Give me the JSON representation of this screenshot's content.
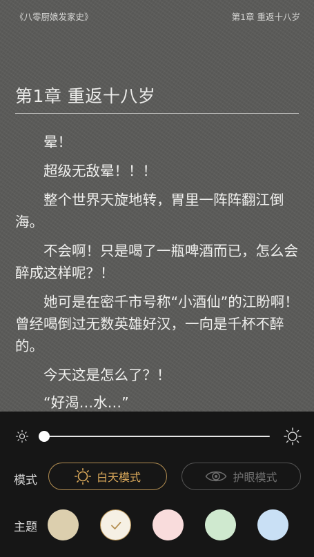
{
  "header": {
    "book_title": "《八零厨娘发家史》",
    "chapter": "第1章  重返十八岁"
  },
  "chapter_title": "第1章 重返十八岁",
  "paragraphs": [
    "晕！",
    "超级无敌晕！！！",
    "整个世界天旋地转，胃里一阵阵翻江倒海。",
    "不会啊！只是喝了一瓶啤酒而已，怎么会醉成这样呢？！",
    "她可是在密千市号称“小酒仙”的江盼啊！曾经喝倒过无数英雄好汉，一向是千杯不醉的。",
    "今天这是怎么了？！",
    "“好渴…水…”"
  ],
  "settings": {
    "brightness": 0.0,
    "mode_label": "模式",
    "day_mode": "白天模式",
    "eye_mode": "护眼模式",
    "theme_label": "主题",
    "themes": [
      {
        "name": "beige",
        "color": "#dccfae",
        "selected": false
      },
      {
        "name": "white",
        "color": "#f6f0e4",
        "selected": true
      },
      {
        "name": "pink",
        "color": "#f9dcdc",
        "selected": false
      },
      {
        "name": "green",
        "color": "#cfe9cf",
        "selected": false
      },
      {
        "name": "blue",
        "color": "#c9e0f5",
        "selected": false
      }
    ],
    "accent": "#d9a85a",
    "check_color": "#b48f52"
  }
}
